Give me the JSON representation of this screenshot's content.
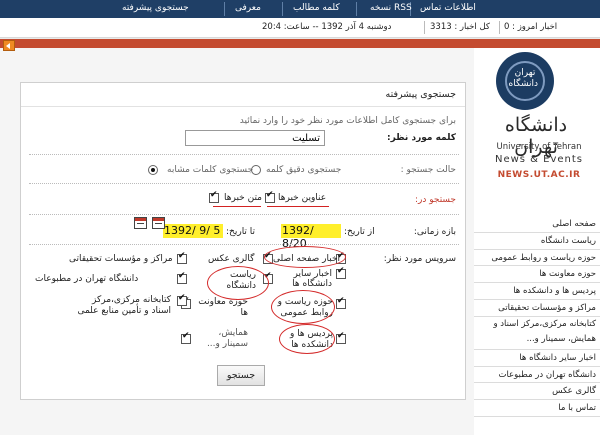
{
  "topnav": {
    "items": [
      "اطلاعات تماس",
      "نسخه RSS",
      "کلمه مطالب",
      "معرفی",
      "جستجوی پیشرفته"
    ]
  },
  "infobar": {
    "today_visits": "اخبار امروز : 0",
    "total_news": "کل اخبار : 3313",
    "datetime": "دوشنبه 4 آذر 1392 -- ساعت: 20:4"
  },
  "logo": {
    "circle_text": "تهران دانشگاه",
    "title_fa": "دانشگاه تهران",
    "en_line1": "University of Tehran",
    "en_line2": "News & Events",
    "url": "NEWS.UT.AC.IR"
  },
  "sidebar": {
    "items": [
      "صفحه اصلی",
      "ریاست دانشگاه",
      "حوزه ریاست و روابط عمومی",
      "حوزه معاونت ها",
      "پردیس ها و دانشکده ها",
      "مراکز و مؤسسات تحقیقاتی",
      "کتابخانه مرکزی،مرکز اسناد و همایش، سمینار و...",
      "اخبار سایر دانشگاه ها",
      "دانشگاه تهران در مطبوعات",
      "گالری عکس",
      "تماس با ما"
    ]
  },
  "form": {
    "header": "جستجوی پیشرفته",
    "instruction": "برای جستجوی کامل اطلاعات مورد نظر خود را وارد نمائید",
    "keyword_label": "کلمه مورد نظر:",
    "keyword_value": "تسلیت",
    "mode_label": "حالت جستجو :",
    "mode_exact": "جستجوی دقیق کلمه",
    "mode_similar": "جستجوی کلمات مشابه",
    "search_in_label": "جستجو در:",
    "search_in_titles": "عناوین خبرها",
    "search_in_body": "متن خبرها",
    "date_label": "بازه زمانی:",
    "date_from_label": "از تاریخ:",
    "date_from_value": "1392/ 8/20",
    "date_to_label": "تا تاریخ:",
    "date_to_value": "1392/ 9/ 5",
    "services_label": "سرویس مورد نظر:",
    "services": [
      "اخبار صفحه اصلی",
      "اخبار سایر دانشگاه ها",
      "حوزه ریاست و روابط عمومی",
      "پردیس ها و دانشکده ها",
      "گالری عکس",
      "ریاست دانشگاه",
      "حوزه معاونت ها",
      "همایش، سمینار و...",
      "مراکز و مؤسسات تحقیقاتی",
      "دانشگاه تهران در مطبوعات",
      "کتابخانه مرکزی،مرکز اسناد و تأمین منابع علمی"
    ],
    "submit_label": "جستجو"
  },
  "colors": {
    "topbar": "#1f3f66",
    "accent": "#c44b30",
    "date_highlight": "#ffef2b",
    "annotation_red": "#d42b2b"
  }
}
